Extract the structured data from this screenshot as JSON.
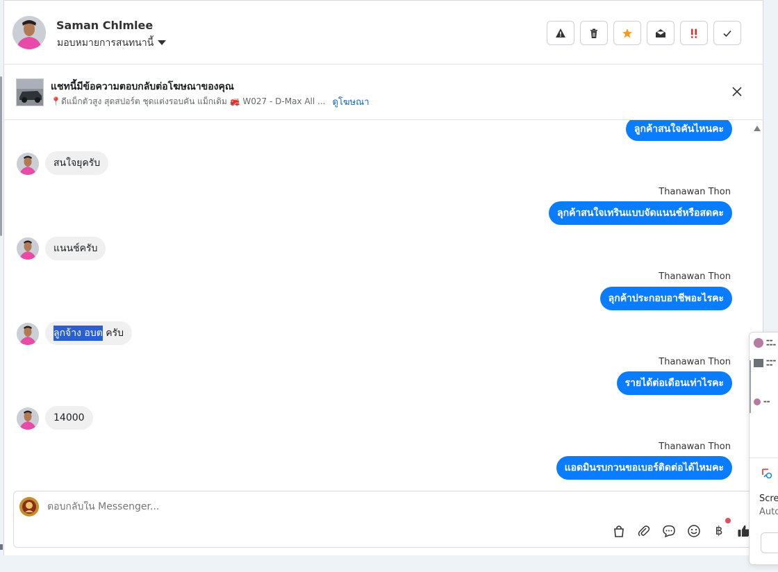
{
  "header": {
    "name": "Saman Chlmlee",
    "assign_label": "มอบหมายการสนทนานี้",
    "actions": [
      {
        "name": "report",
        "icon": "warning-icon"
      },
      {
        "name": "delete",
        "icon": "trash-icon"
      },
      {
        "name": "star",
        "icon": "star-icon",
        "color": "#f59a23"
      },
      {
        "name": "mark-unread",
        "icon": "envelope-open-icon"
      },
      {
        "name": "important",
        "icon": "double-exclamation-icon",
        "color": "#e0312f"
      },
      {
        "name": "done",
        "icon": "check-icon"
      }
    ]
  },
  "ad": {
    "title": "แชทนี้มีข้อความตอบกลับต่อโฆษณาของคุณ",
    "subtitle": "📍ดีแม็กตัวสูง สุดสปอร์ต ชุดแต่งรอบคัน แม็กเดิม 🚒 W027 - D-Max All ...",
    "link": "ดูโฆษณา"
  },
  "messages": [
    {
      "dir": "out",
      "text": "ลูกค้าสนใจคันไหนคะ"
    },
    {
      "dir": "in",
      "text": "สนใจยุครับ"
    },
    {
      "dir": "out",
      "sender": "Thanawan Thon",
      "text": "ลุกค้าสนใจเทรินแบบจัดแนนช์หรือสดคะ"
    },
    {
      "dir": "in",
      "text": "แนนช์ครับ"
    },
    {
      "dir": "out",
      "sender": "Thanawan Thon",
      "text": "ลุกค้าประกอบอาชีพอะไรคะ"
    },
    {
      "dir": "in",
      "highlight": "ลูกจ้าง อบต",
      "text": " ครับ"
    },
    {
      "dir": "out",
      "sender": "Thanawan Thon",
      "text": "รายได้ต่อเดือนเท่าไรคะ"
    },
    {
      "dir": "in",
      "text": "14000"
    },
    {
      "dir": "out",
      "sender": "Thanawan Thon",
      "text": "แอดมินรบกวนขอเบอร์ติดต่อได้ไหมคะ"
    }
  ],
  "composer": {
    "placeholder": "ตอบกลับใน Messenger...",
    "tools": [
      "shopping-bag-icon",
      "paperclip-icon",
      "chat-bubble-icon",
      "smiley-icon",
      "baht-icon",
      "thumbs-up-icon"
    ],
    "currency_symbol": "฿"
  },
  "popup": {
    "text1": "Scre",
    "text2": "Auto"
  },
  "colors": {
    "accent": "#0a7cff",
    "link": "#1565c0",
    "highlight": "#2b5fd1"
  }
}
